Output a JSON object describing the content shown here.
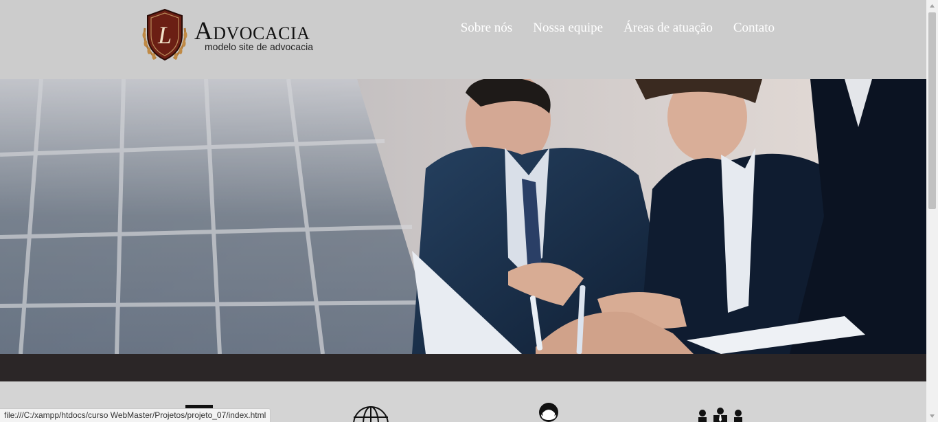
{
  "brand": {
    "initial": "L",
    "title": "Advocacia",
    "subtitle": "modelo site de advocacia"
  },
  "nav": {
    "items": [
      {
        "label": "Sobre nós"
      },
      {
        "label": "Nossa equipe"
      },
      {
        "label": "Áreas de atuação"
      },
      {
        "label": "Contato"
      }
    ]
  },
  "features": [
    {
      "icon": "columns-icon"
    },
    {
      "icon": "globe-icon"
    },
    {
      "icon": "user-head-icon"
    },
    {
      "icon": "team-icon"
    }
  ],
  "statusbar": {
    "url": "file:///C:/xampp/htdocs/curso WebMaster/Projetos/projeto_07/index.html"
  },
  "colors": {
    "header_bg": "#cccccc",
    "dark_band": "#2b2627",
    "features_bg": "#d4d4d4",
    "logo_maroon": "#6b1f14",
    "suit_navy": "#1d3350"
  }
}
